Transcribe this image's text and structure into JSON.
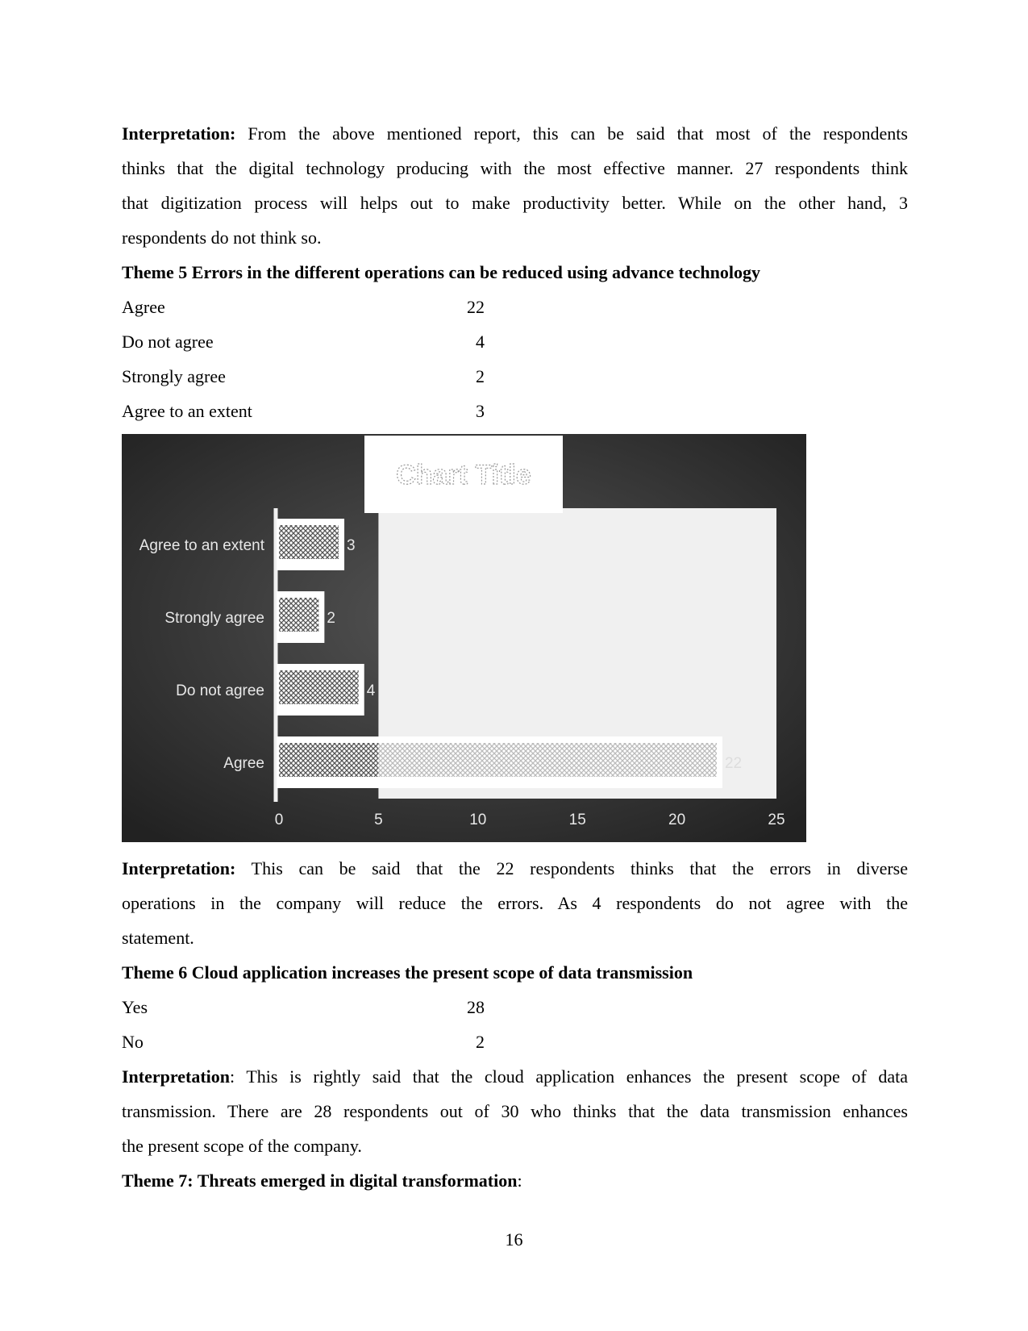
{
  "para1": {
    "label": "Interpretation:",
    "lines": [
      " From the above mentioned report, this can be said that most of the respondents",
      "thinks that the digital technology producing with the most effective manner. 27 respondents think",
      "that digitization process will helps out to make productivity better. While on the other hand, 3",
      "respondents do not think so."
    ]
  },
  "theme5": {
    "heading": "Theme 5 Errors in the different operations can be reduced using advance technology",
    "rows": [
      {
        "label": "Agree",
        "value": "22"
      },
      {
        "label": "Do not agree",
        "value": "4"
      },
      {
        "label": "Strongly agree",
        "value": "2"
      },
      {
        "label": "Agree to an extent",
        "value": "3"
      }
    ]
  },
  "chart_data": {
    "type": "bar",
    "orientation": "horizontal",
    "title": "Chart Title",
    "categories": [
      "Agree",
      "Do not agree",
      "Strongly agree",
      "Agree to an extent"
    ],
    "values": [
      22,
      4,
      2,
      3
    ],
    "xlim": [
      0,
      25
    ],
    "xticks": [
      "0",
      "5",
      "10",
      "15",
      "20",
      "25"
    ],
    "data_labels": [
      "22",
      "4",
      "2",
      "3"
    ],
    "grid": false,
    "legend": "none",
    "colors": {
      "background": "#3a3a3a",
      "plot_area": "#f0f0f0",
      "bar_pattern": "#555555",
      "label_text": "#e8e8e8"
    }
  },
  "para2": {
    "label": "Interpretation:",
    "lines": [
      " This can be said that the 22 respondents thinks that the errors in diverse",
      "operations in the company will reduce the errors. As 4 respondents do not agree with the",
      "statement."
    ]
  },
  "theme6": {
    "heading": "Theme 6 Cloud application increases the present scope of data transmission",
    "rows": [
      {
        "label": "Yes",
        "value": "28"
      },
      {
        "label": "No",
        "value": "2"
      }
    ]
  },
  "para3": {
    "label": "Interpretation",
    "lines": [
      ": This is rightly said that the cloud application enhances the present scope of data",
      "transmission. There are 28 respondents out of 30 who thinks that the data transmission enhances",
      "the present scope of the company."
    ]
  },
  "theme7": {
    "heading": "Theme 7: Threats emerged in digital transformation",
    "suffix": ":"
  },
  "page_number": "16"
}
